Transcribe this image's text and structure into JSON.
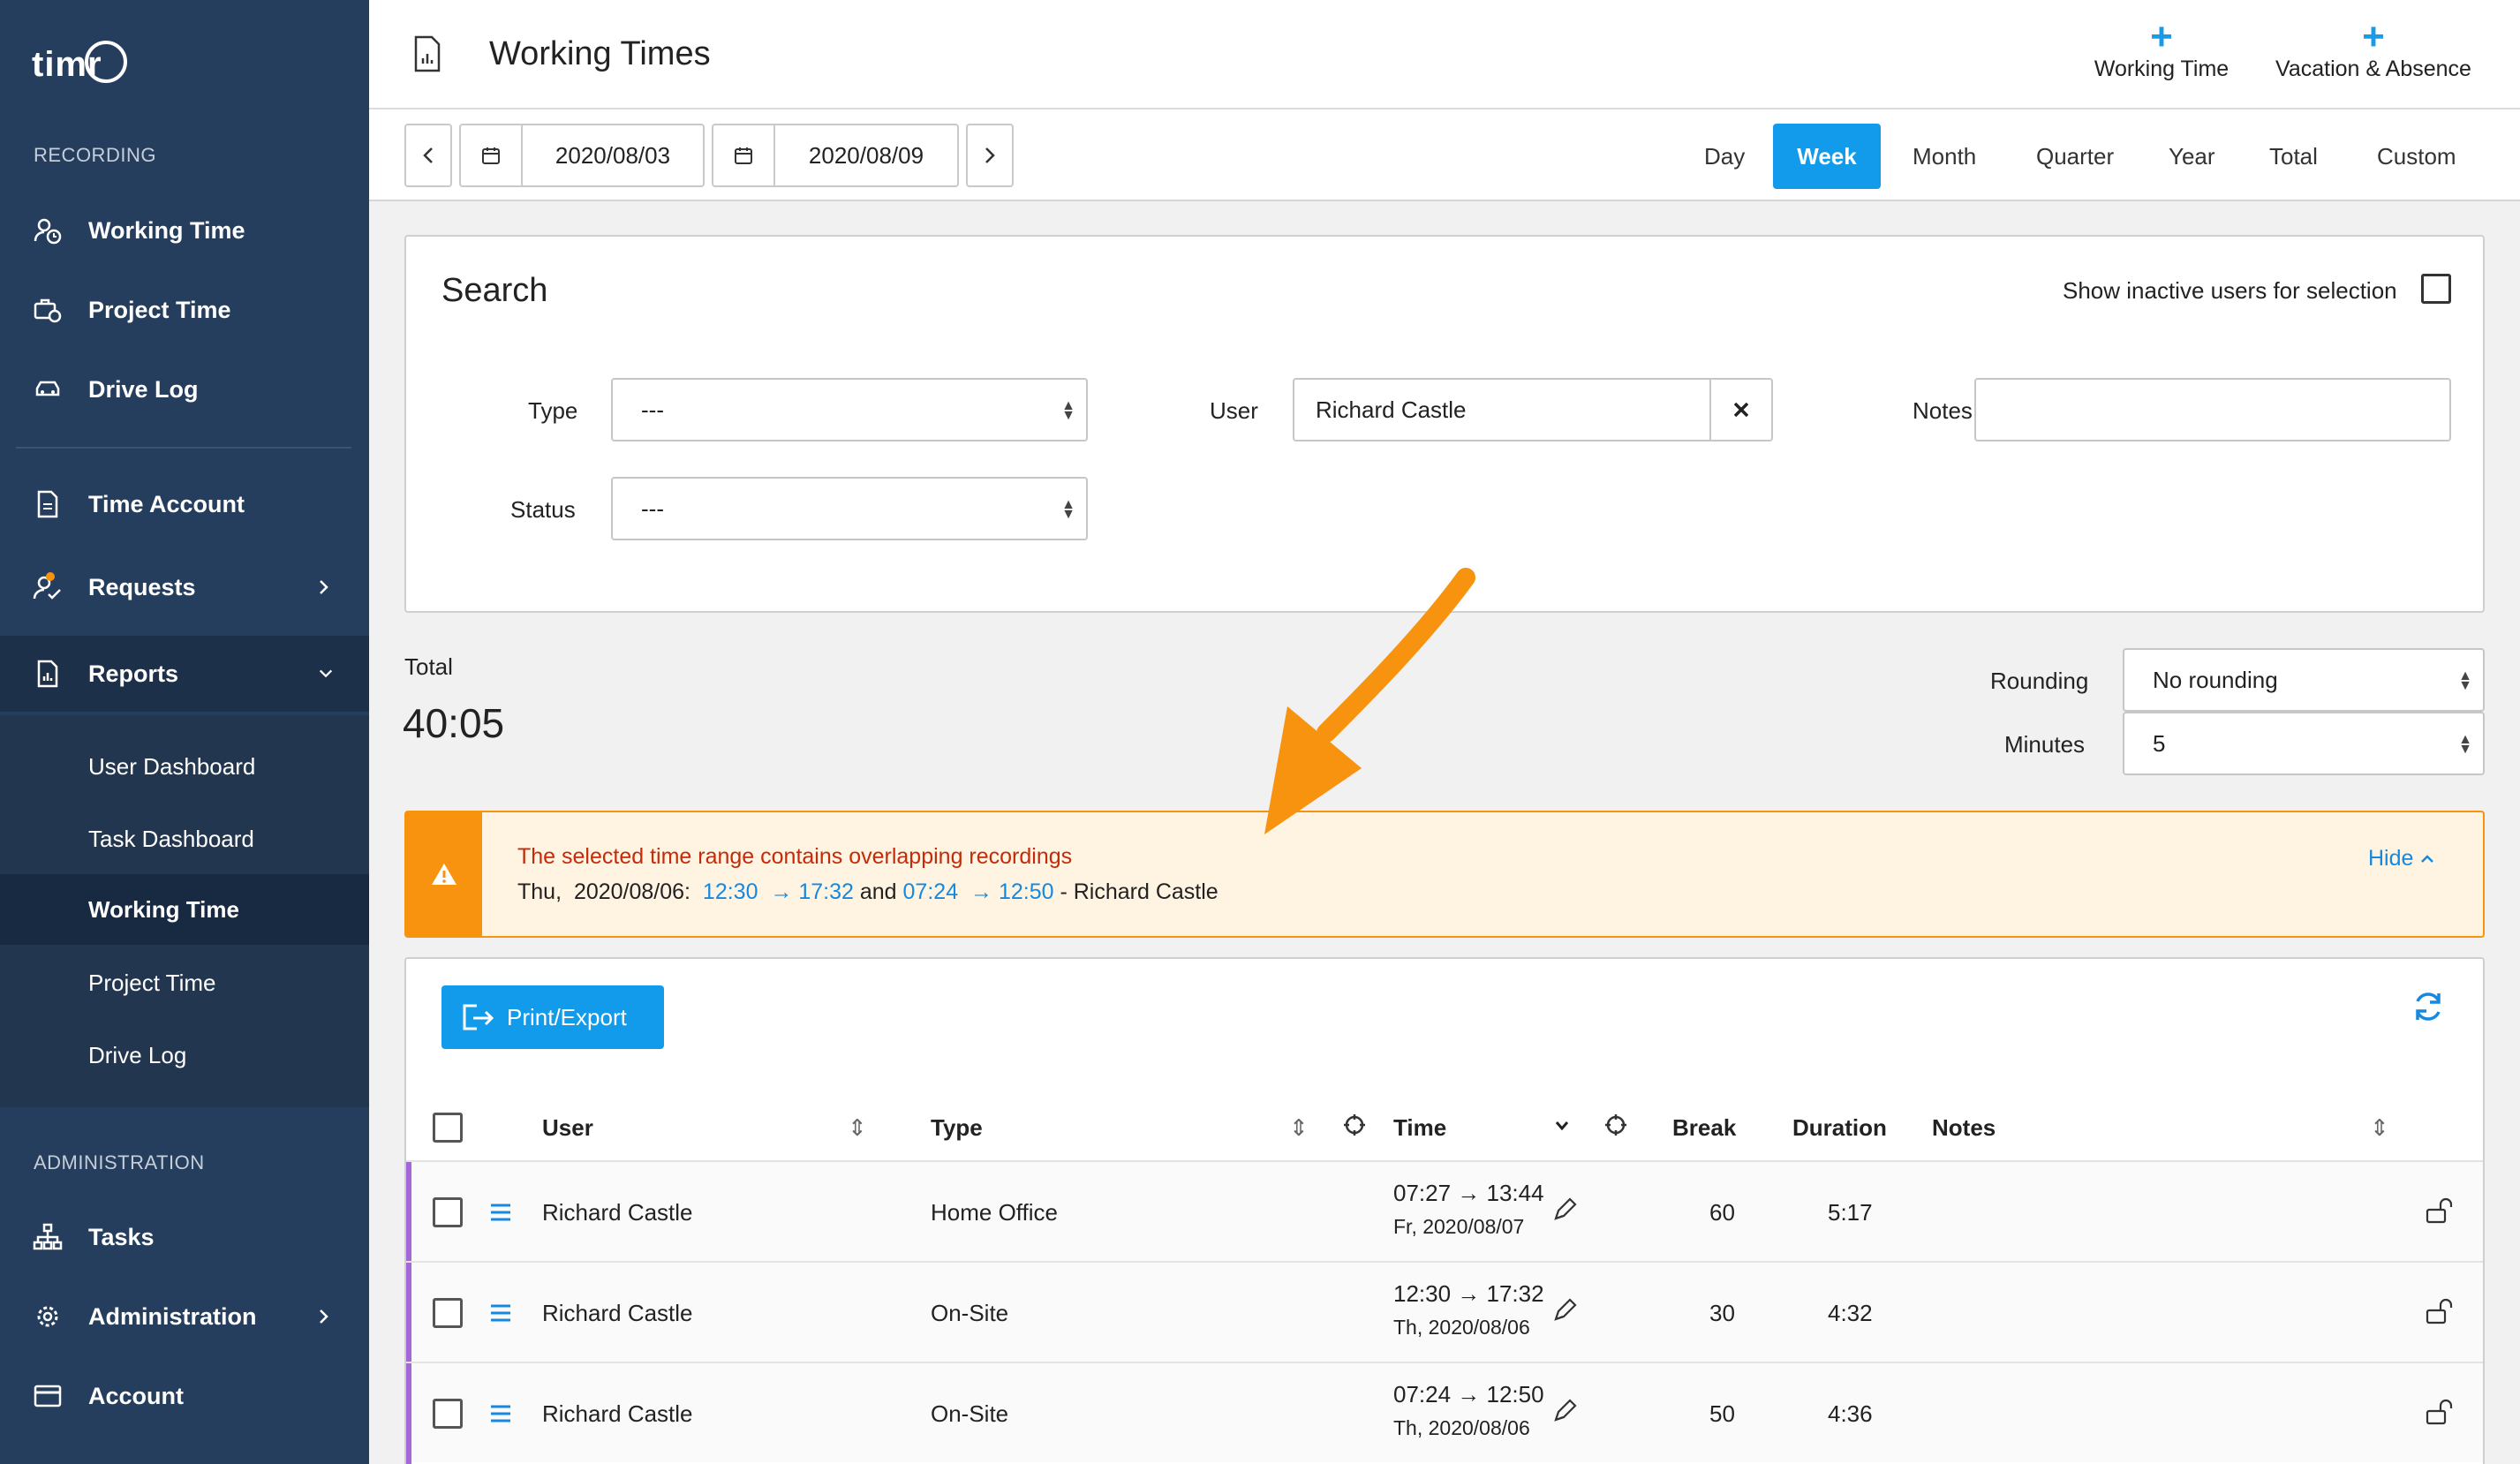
{
  "app": {
    "logo": "timr"
  },
  "sidebar": {
    "recording_title": "RECORDING",
    "admin_title": "ADMINISTRATION",
    "items": [
      {
        "label": "Working Time",
        "icon": "user-clock-icon"
      },
      {
        "label": "Project Time",
        "icon": "briefcase-clock-icon"
      },
      {
        "label": "Drive Log",
        "icon": "car-icon"
      },
      {
        "label": "Time Account",
        "icon": "document-icon"
      },
      {
        "label": "Requests",
        "icon": "user-check-icon"
      },
      {
        "label": "Reports",
        "icon": "report-icon"
      }
    ],
    "report_sub": [
      "User Dashboard",
      "Task Dashboard",
      "Working Time",
      "Project Time",
      "Drive Log"
    ],
    "admin_items": [
      {
        "label": "Tasks",
        "icon": "hierarchy-icon"
      },
      {
        "label": "Administration",
        "icon": "gear-icon"
      },
      {
        "label": "Account",
        "icon": "credit-card-icon"
      }
    ]
  },
  "header": {
    "title": "Working Times",
    "add_working_time": "Working Time",
    "add_vacation": "Vacation & Absence"
  },
  "toolbar": {
    "date_from": "2020/08/03",
    "date_to": "2020/08/09",
    "ranges": [
      "Day",
      "Week",
      "Month",
      "Quarter",
      "Year",
      "Total",
      "Custom"
    ],
    "active_range": "Week"
  },
  "search": {
    "title": "Search",
    "inactive_label": "Show inactive users for selection",
    "type_label": "Type",
    "type_value": "---",
    "status_label": "Status",
    "status_value": "---",
    "user_label": "User",
    "user_value": "Richard Castle",
    "notes_label": "Notes",
    "notes_value": ""
  },
  "summary": {
    "total_label": "Total",
    "total_value": "40:05",
    "rounding_label": "Rounding",
    "rounding_value": "No rounding",
    "minutes_label": "Minutes",
    "minutes_value": "5"
  },
  "warning": {
    "title": "The selected time range contains overlapping recordings",
    "day": "Thu,",
    "date": "2020/08/06:",
    "t1_start": "12:30",
    "t1_end": "→ 17:32",
    "and": "and",
    "t2_start": "07:24",
    "t2_end": "→ 12:50",
    "user": "- Richard Castle",
    "hide": "Hide"
  },
  "table": {
    "print_label": "Print/Export",
    "columns": {
      "user": "User",
      "type": "Type",
      "time": "Time",
      "break": "Break",
      "duration": "Duration",
      "notes": "Notes"
    },
    "rows": [
      {
        "user": "Richard Castle",
        "type": "Home Office",
        "time": "07:27 → 13:44",
        "date": "Fr, 2020/08/07",
        "break": "60",
        "duration": "5:17"
      },
      {
        "user": "Richard Castle",
        "type": "On-Site",
        "time": "12:30 → 17:32",
        "date": "Th, 2020/08/06",
        "break": "30",
        "duration": "4:32"
      },
      {
        "user": "Richard Castle",
        "type": "On-Site",
        "time": "07:24 → 12:50",
        "date": "Th, 2020/08/06",
        "break": "50",
        "duration": "4:36"
      }
    ]
  },
  "colors": {
    "sidebar": "#263e5d",
    "accent": "#129bea",
    "warning": "#f7930f",
    "warning_bg": "#fff3e2",
    "row_marker": "#a566d8"
  }
}
